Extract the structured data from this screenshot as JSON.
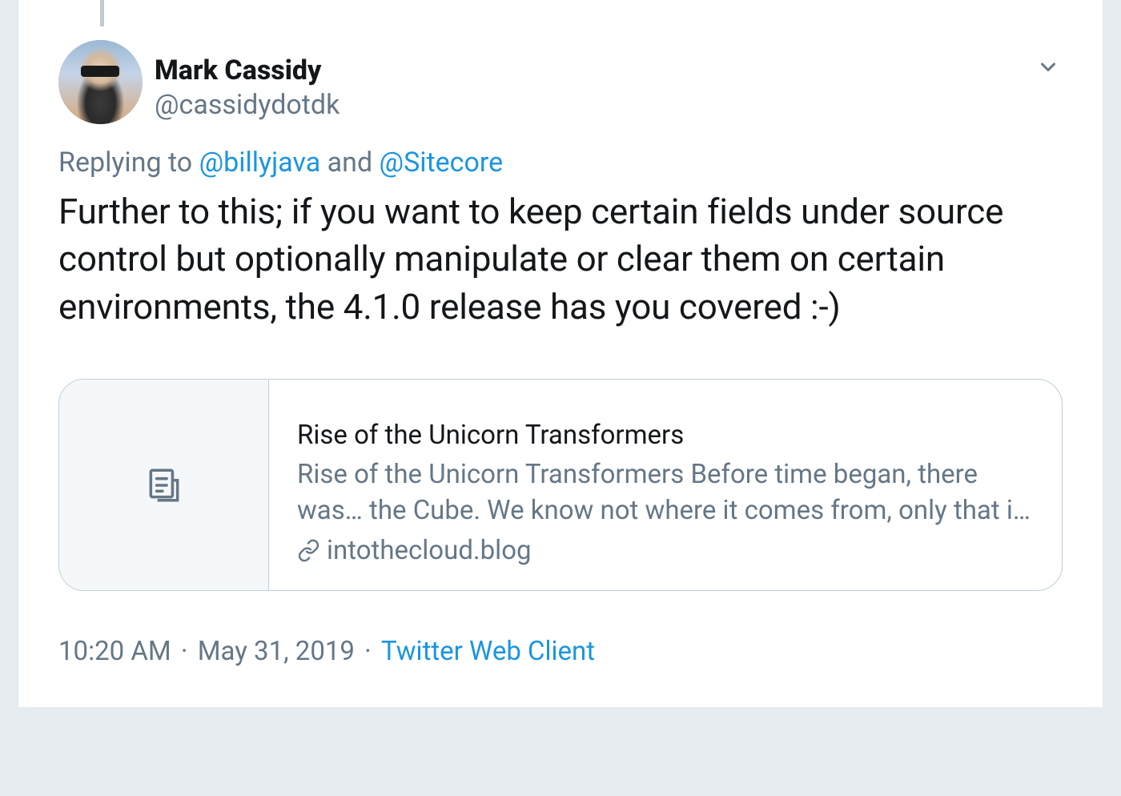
{
  "tweet": {
    "author": {
      "display_name": "Mark Cassidy",
      "username": "@cassidydotdk"
    },
    "reply_context": {
      "prefix": "Replying to ",
      "mention1": "@billyjava",
      "connector": " and ",
      "mention2": "@Sitecore"
    },
    "text": "Further to this; if you want to keep certain fields under source control but optionally manipulate or clear them on certain environments, the 4.1.0 release has you covered :-)",
    "link_card": {
      "title": "Rise of the Unicorn Transformers",
      "description": "Rise of the Unicorn Transformers Before time began, there was… the Cube. We know not where it comes from, only that it holds …",
      "domain": "intothecloud.blog"
    },
    "meta": {
      "time": "10:20 AM",
      "date": "May 31, 2019",
      "source": "Twitter Web Client"
    }
  }
}
